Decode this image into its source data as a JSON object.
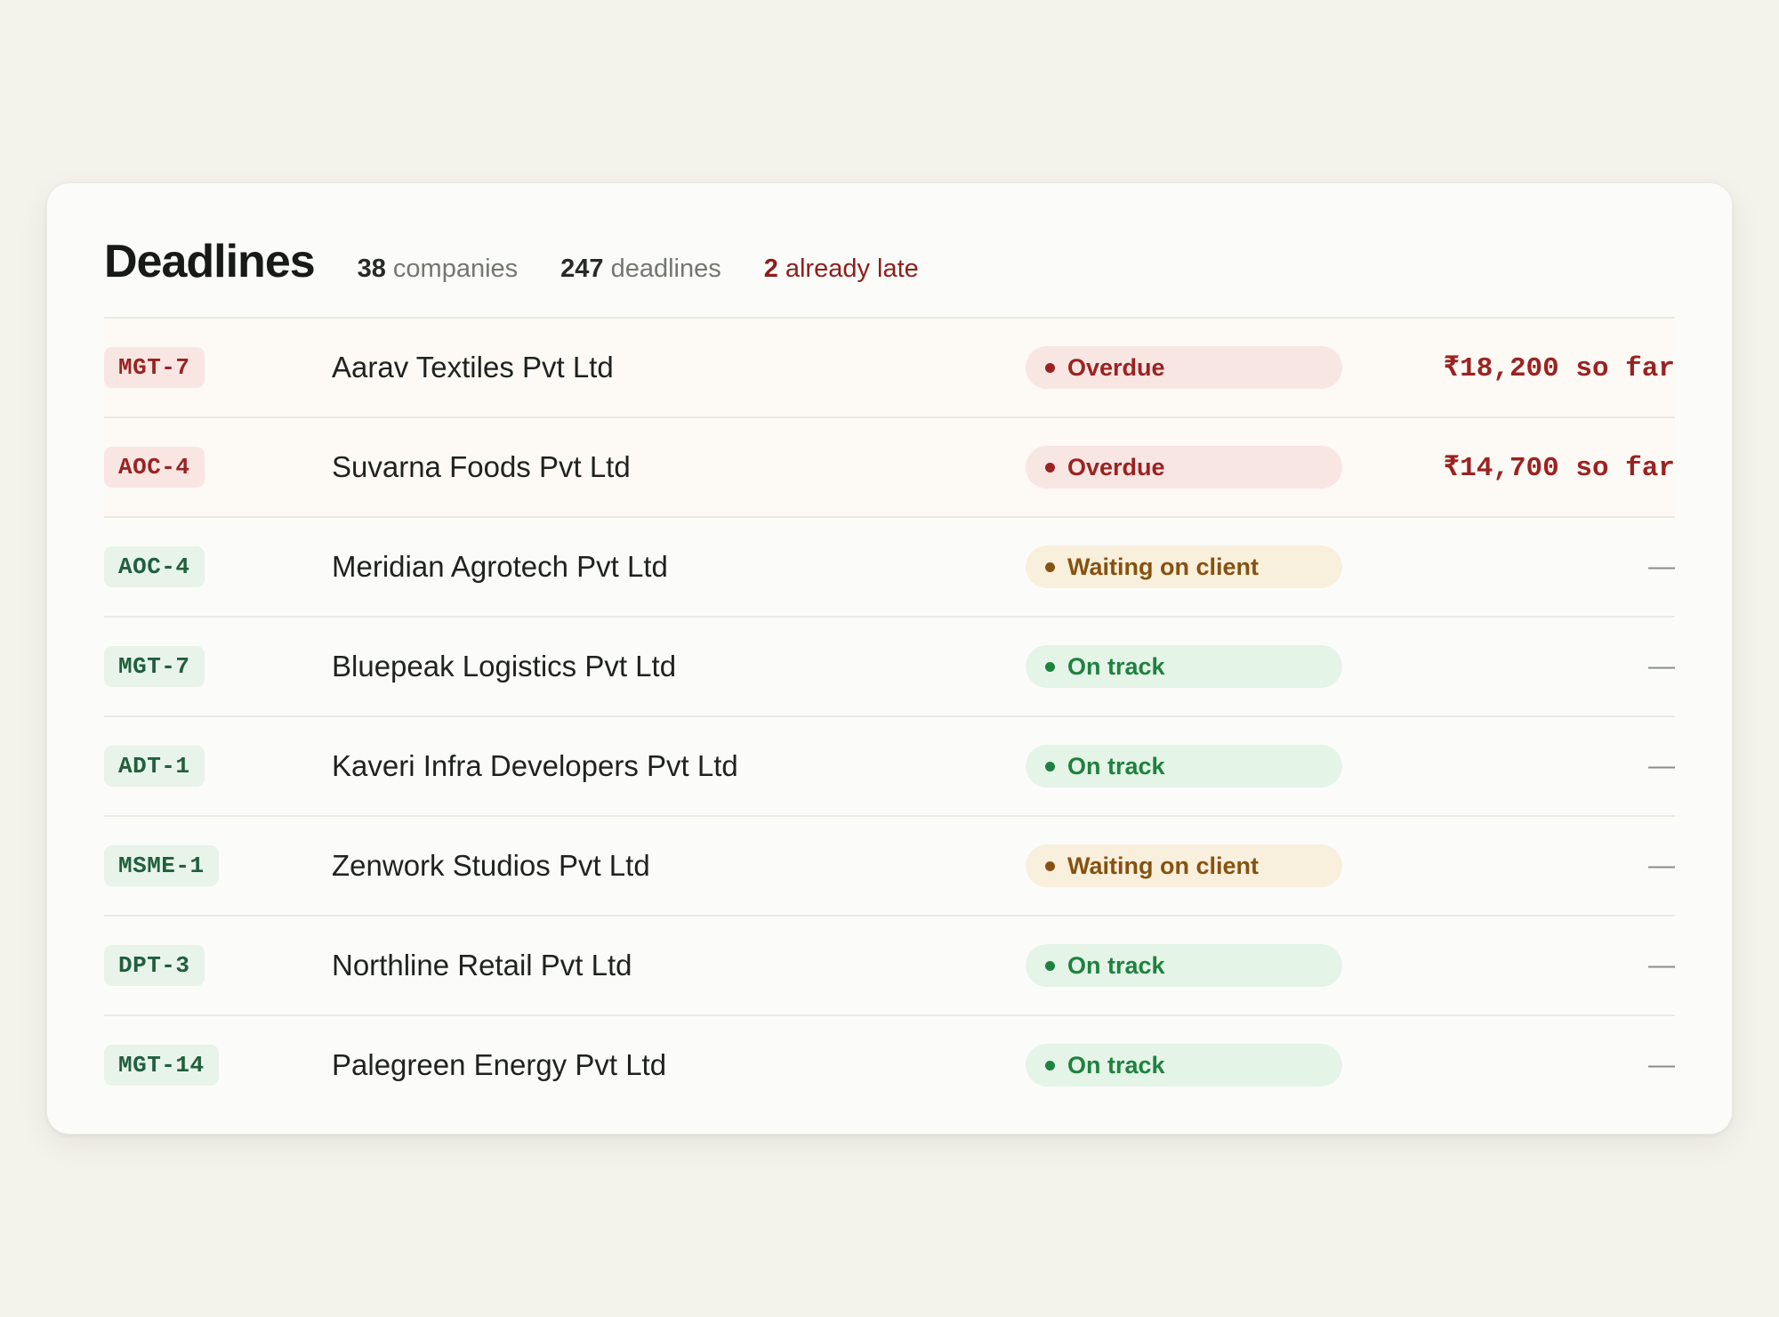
{
  "header": {
    "title": "Deadlines",
    "stats": [
      {
        "num": "38",
        "label": "companies",
        "tone": "normal"
      },
      {
        "num": "247",
        "label": "deadlines",
        "tone": "normal"
      },
      {
        "num": "2",
        "label": "already late",
        "tone": "late"
      }
    ]
  },
  "rows": [
    {
      "form": "MGT-7",
      "company": "Aarav Textiles Pvt Ltd",
      "status": "Overdue",
      "status_kind": "overdue",
      "penalty": "₹18,200 so far"
    },
    {
      "form": "AOC-4",
      "company": "Suvarna Foods Pvt Ltd",
      "status": "Overdue",
      "status_kind": "overdue",
      "penalty": "₹14,700 so far"
    },
    {
      "form": "AOC-4",
      "company": "Meridian Agrotech Pvt Ltd",
      "status": "Waiting on client",
      "status_kind": "waiting",
      "penalty": "—"
    },
    {
      "form": "MGT-7",
      "company": "Bluepeak Logistics Pvt Ltd",
      "status": "On track",
      "status_kind": "ontrack",
      "penalty": "—"
    },
    {
      "form": "ADT-1",
      "company": "Kaveri Infra Developers Pvt Ltd",
      "status": "On track",
      "status_kind": "ontrack",
      "penalty": "—"
    },
    {
      "form": "MSME-1",
      "company": "Zenwork Studios Pvt Ltd",
      "status": "Waiting on client",
      "status_kind": "waiting",
      "penalty": "—"
    },
    {
      "form": "DPT-3",
      "company": "Northline Retail Pvt Ltd",
      "status": "On track",
      "status_kind": "ontrack",
      "penalty": "—"
    },
    {
      "form": "MGT-14",
      "company": "Palegreen Energy Pvt Ltd",
      "status": "On track",
      "status_kind": "ontrack",
      "penalty": "—"
    }
  ],
  "colors": {
    "overdue": "#9a2321",
    "waiting": "#86520f",
    "ontrack": "#1f8140"
  }
}
